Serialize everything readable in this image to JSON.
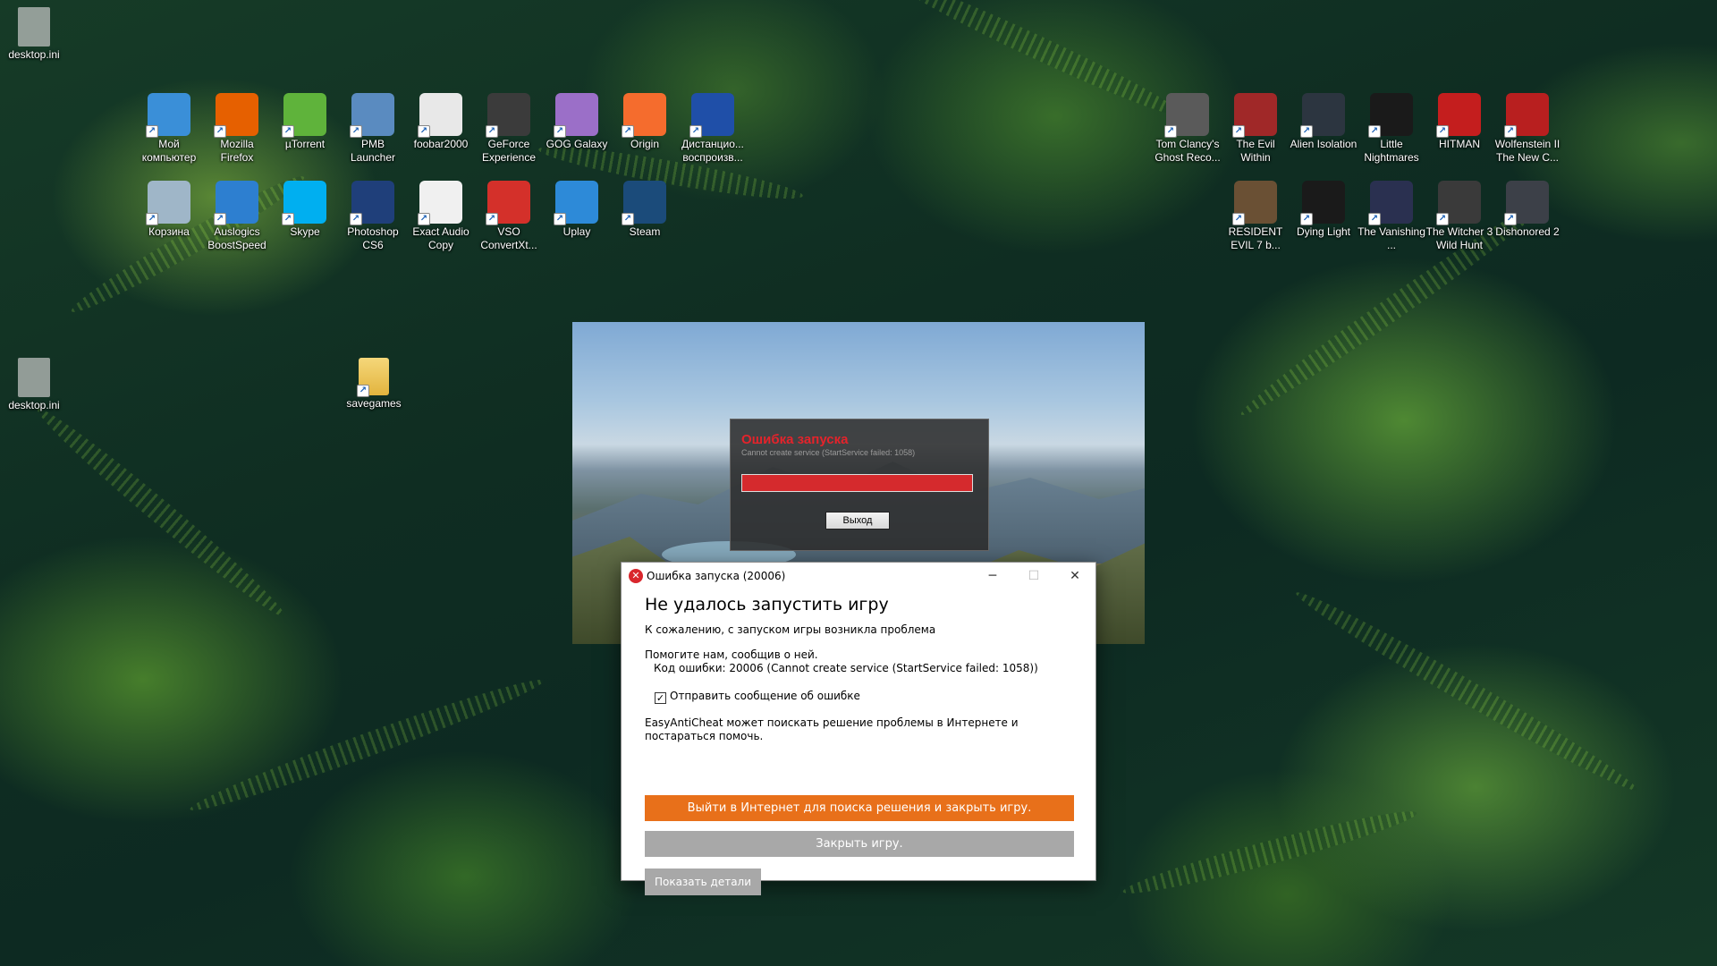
{
  "desktop": {
    "icons_left_top": [
      {
        "name": "desktop.ini"
      }
    ],
    "row1_left": [
      {
        "label": "Мой компьютер",
        "icon": "computer-icon",
        "color": "#3a8fd8"
      },
      {
        "label": "Mozilla Firefox",
        "icon": "firefox-icon",
        "color": "#e66000"
      },
      {
        "label": "µTorrent",
        "icon": "utorrent-icon",
        "color": "#5fb33b"
      },
      {
        "label": "PMB Launcher",
        "icon": "pmb-icon",
        "color": "#5a8bc0"
      },
      {
        "label": "foobar2000",
        "icon": "foobar-icon",
        "color": "#e8e8e8"
      },
      {
        "label": "GeForce Experience",
        "icon": "geforce-icon",
        "color": "#3b3b3b"
      },
      {
        "label": "GOG Galaxy",
        "icon": "gog-icon",
        "color": "#9b6fc8"
      },
      {
        "label": "Origin",
        "icon": "origin-icon",
        "color": "#f56c2d"
      },
      {
        "label": "Дистанцио... воспроизв...",
        "icon": "ps4-remote-icon",
        "color": "#1f4fa8"
      }
    ],
    "row2_left": [
      {
        "label": "Корзина",
        "icon": "recycle-bin-icon",
        "color": "#9fb6c8"
      },
      {
        "label": "Auslogics BoostSpeed",
        "icon": "auslogics-icon",
        "color": "#2d7fd0"
      },
      {
        "label": "Skype",
        "icon": "skype-icon",
        "color": "#00aff0"
      },
      {
        "label": "Photoshop CS6",
        "icon": "photoshop-icon",
        "color": "#1f3f7a"
      },
      {
        "label": "Exact Audio Copy",
        "icon": "eac-icon",
        "color": "#f0f0f0"
      },
      {
        "label": "VSO ConvertXt...",
        "icon": "vso-icon",
        "color": "#d4302a"
      },
      {
        "label": "Uplay",
        "icon": "uplay-icon",
        "color": "#2d8ad8"
      },
      {
        "label": "Steam",
        "icon": "steam-icon",
        "color": "#1b4b7a"
      }
    ],
    "row1_right": [
      {
        "label": "Tom Clancy's Ghost Reco...",
        "icon": "ghost-recon-icon",
        "color": "#5a5a5a"
      },
      {
        "label": "The Evil Within",
        "icon": "evil-within-icon",
        "color": "#a02828"
      },
      {
        "label": "Alien Isolation",
        "icon": "alien-isolation-icon",
        "color": "#2c3540"
      },
      {
        "label": "Little Nightmares",
        "icon": "little-nightmares-icon",
        "color": "#1a1a1a"
      },
      {
        "label": "HITMAN",
        "icon": "hitman-icon",
        "color": "#c41e1e"
      },
      {
        "label": "Wolfenstein II The New C...",
        "icon": "wolfenstein-icon",
        "color": "#b81f1f"
      }
    ],
    "row2_right": [
      {
        "label": "RESIDENT EVIL 7 b...",
        "icon": "resident-evil-icon",
        "color": "#6a5034"
      },
      {
        "label": "Dying Light",
        "icon": "dying-light-icon",
        "color": "#1a1a1a"
      },
      {
        "label": "The Vanishing ...",
        "icon": "vanishing-icon",
        "color": "#2a3050"
      },
      {
        "label": "The Witcher 3 Wild Hunt",
        "icon": "witcher-icon",
        "color": "#3a3a3a"
      },
      {
        "label": "Dishonored 2",
        "icon": "dishonored-icon",
        "color": "#3c4048"
      }
    ],
    "misc": {
      "desktop_ini_2": "desktop.ini",
      "savegames": "savegames"
    }
  },
  "launcher": {
    "error_title": "Ошибка запуска",
    "error_sub": "Cannot create service (StartService failed: 1058)",
    "exit_button": "Выход"
  },
  "dialog": {
    "title": "Ошибка запуска (20006)",
    "heading": "Не удалось запустить игру",
    "apology": "К сожалению, с запуском игры возникла проблема",
    "help_line": "Помогите нам, сообщив о ней.",
    "error_code": "Код ошибки: 20006 (Cannot create service (StartService failed: 1058))",
    "send_report": "Отправить сообщение об ошибке",
    "send_report_checked": true,
    "search_text": "EasyAntiCheat может поискать решение проблемы в Интернете и постараться помочь.",
    "online_button": "Выйти в Интернет для поиска решения и закрыть игру.",
    "close_button": "Закрыть игру.",
    "details_button": "Показать детали"
  },
  "colors": {
    "orange_button": "#e8701a",
    "error_red": "#e4232b",
    "gray_button": "#a8a8a8"
  }
}
